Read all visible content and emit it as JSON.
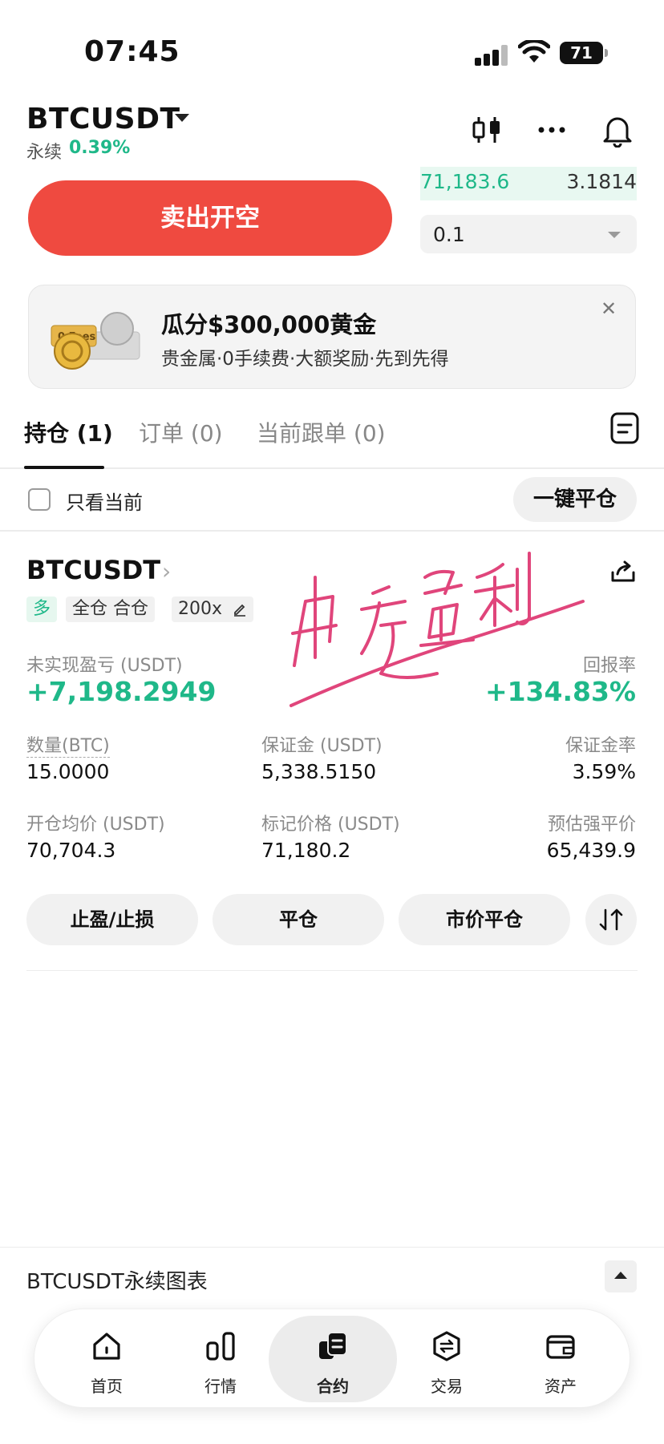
{
  "status_bar": {
    "time": "07:45",
    "battery": "71"
  },
  "header": {
    "symbol": "BTCUSDT",
    "contract_type": "永续",
    "change_pct": "0.39%"
  },
  "trade": {
    "sell_button": "卖出开空",
    "orderbook_price": "71,183.6",
    "orderbook_qty": "3.1814",
    "qty_value": "0.1"
  },
  "promo": {
    "title": "瓜分$300,000黄金",
    "subtitle": "贵金属·0手续费·大额奖励·先到先得",
    "art_text": "0 Fees"
  },
  "tabs": [
    {
      "label": "持仓 (1)",
      "active": true
    },
    {
      "label": "订单 (0)",
      "active": false
    },
    {
      "label": "当前跟单 (0)",
      "active": false
    }
  ],
  "filter": {
    "label": "只看当前",
    "close_all": "一键平仓"
  },
  "position": {
    "symbol": "BTCUSDT",
    "side": "多",
    "margin_mode": "全仓 合仓",
    "leverage": "200x",
    "pnl_label": "未实现盈亏 (USDT)",
    "pnl_value": "+7,198.2949",
    "roe_label": "回报率",
    "roe_value": "+134.83%",
    "qty_label": "数量(BTC)",
    "qty_value": "15.0000",
    "margin_label": "保证金 (USDT)",
    "margin_value": "5,338.5150",
    "margin_ratio_label": "保证金率",
    "margin_ratio_value": "3.59%",
    "entry_label": "开仓均价 (USDT)",
    "entry_value": "70,704.3",
    "mark_label": "标记价格 (USDT)",
    "mark_value": "71,180.2",
    "liq_label": "预估强平价",
    "liq_value": "65,439.9",
    "buttons": {
      "tp_sl": "止盈/止损",
      "close": "平仓",
      "market_close": "市价平仓"
    }
  },
  "chart_footer": {
    "label": "BTCUSDT永续图表"
  },
  "nav": [
    {
      "label": "首页",
      "icon": "home-icon"
    },
    {
      "label": "行情",
      "icon": "markets-icon"
    },
    {
      "label": "合约",
      "icon": "futures-icon",
      "active": true
    },
    {
      "label": "交易",
      "icon": "trade-icon"
    },
    {
      "label": "资产",
      "icon": "wallet-icon"
    }
  ],
  "colors": {
    "green": "#1fb889",
    "red": "#ef4a40",
    "signature": "#e0457b"
  }
}
